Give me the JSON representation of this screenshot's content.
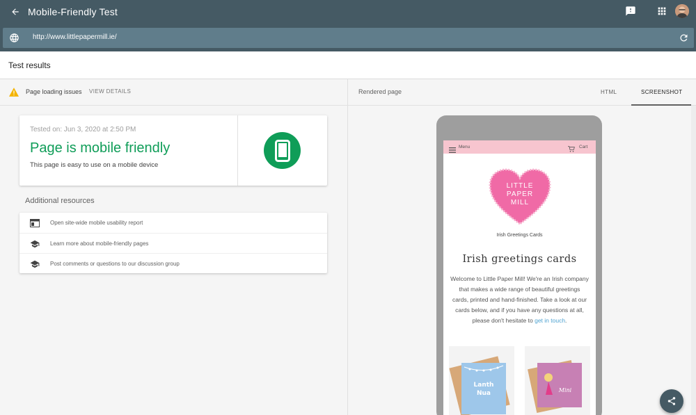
{
  "app": {
    "title": "Mobile-Friendly Test"
  },
  "url_bar": {
    "url": "http://www.littlepapermill.ie/"
  },
  "results": {
    "title": "Test results"
  },
  "issues": {
    "text": "Page loading issues",
    "action": "VIEW DETAILS"
  },
  "verdict": {
    "tested_on": "Tested on: Jun 3, 2020 at 2:50 PM",
    "title": "Page is mobile friendly",
    "subtitle": "This page is easy to use on a mobile device",
    "status_color": "#0f9d58"
  },
  "additional_resources": {
    "title": "Additional resources",
    "items": [
      {
        "icon": "web-page-icon",
        "label": "Open site-wide mobile usability report"
      },
      {
        "icon": "school-icon",
        "label": "Learn more about mobile-friendly pages"
      },
      {
        "icon": "school-icon",
        "label": "Post comments or questions to our discussion group"
      }
    ]
  },
  "rendered": {
    "label": "Rendered page",
    "tabs": [
      {
        "label": "HTML",
        "active": false
      },
      {
        "label": "SCREENSHOT",
        "active": true
      }
    ]
  },
  "site": {
    "menu": "Menu",
    "cart": "Cart",
    "logo": [
      "LITTLE",
      "PAPER",
      "MILL"
    ],
    "tagline": "Irish Greetings Cards",
    "heading": "Irish greetings cards",
    "paragraph": "Welcome to Little Paper Mill! We're an Irish company that makes a wide range of beautiful greetings cards, printed and hand-finished. Take a look at our cards below, and if you have any questions at all, please don't hesitate to ",
    "link": "get in touch",
    "paragraph_end": ".",
    "card1_text": [
      "Lanth",
      "Nua"
    ],
    "card2_text": "Mini",
    "brand_pink": "#f06aa6"
  },
  "colors": {
    "appbar": "#455a64",
    "urlbar": "#607d8b",
    "accent_green": "#0f9d58",
    "warning": "#f4b400"
  }
}
